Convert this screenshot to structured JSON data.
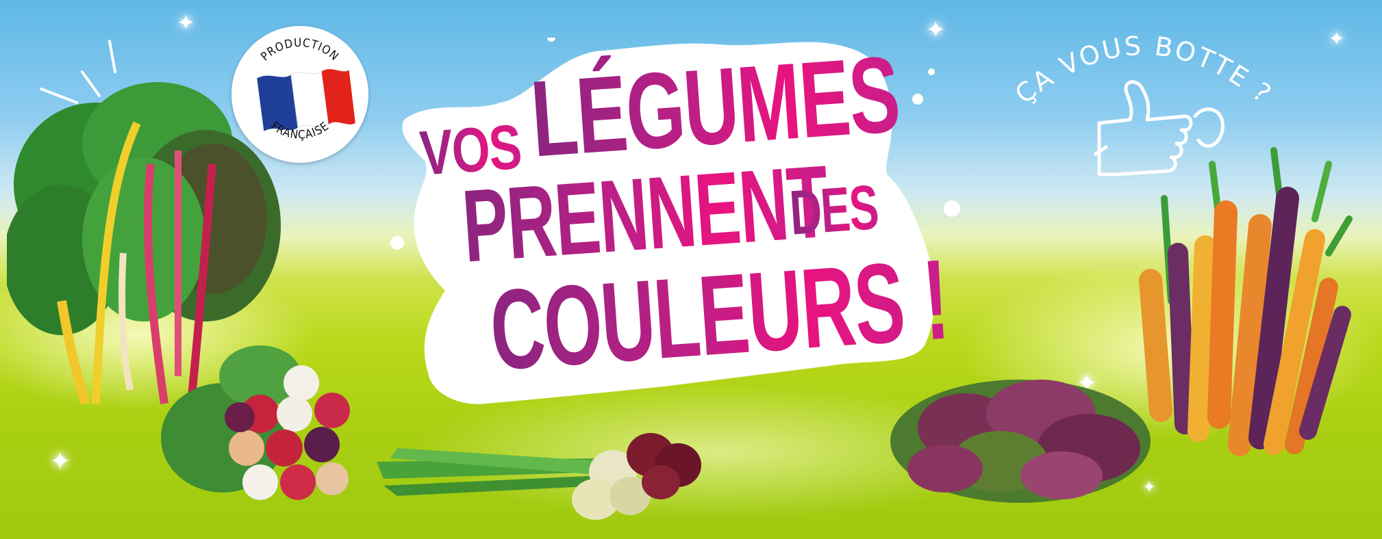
{
  "banner": {
    "badge": {
      "top_text": "PRODUCTION",
      "bottom_text": "FRANÇAISE",
      "flag_colors": [
        "#1f3f99",
        "#ffffff",
        "#e2231a"
      ]
    },
    "headline": {
      "line1_small": "VOS",
      "line1_big": "LÉGUMES",
      "line2_big": "PRENNENT",
      "line2_small": "DES",
      "line3_big": "COULEURS !"
    },
    "tagline": "ÇA VOUS BOTTE ?",
    "colors": {
      "sky": "#5fb8e6",
      "grass": "#a9cf12",
      "magenta": "#e8137f",
      "purple": "#8b2580"
    },
    "vegetables": [
      "swiss-chard",
      "radishes",
      "spring-onions",
      "red-amaranth",
      "heirloom-carrots"
    ]
  }
}
